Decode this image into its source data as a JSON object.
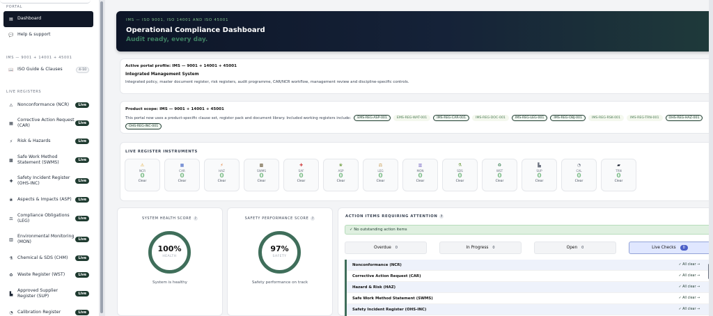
{
  "sidebar": {
    "sections": {
      "portal": "PORTAL",
      "ims": "IMS — 9001 + 14001 + 45001",
      "live": "LIVE REGISTERS"
    },
    "items": [
      {
        "label": "Dashboard",
        "icon": "dashboard-icon",
        "glyph": "▤"
      },
      {
        "label": "Help & support",
        "icon": "chat-icon",
        "glyph": "💬"
      },
      {
        "label": "ISO Guide & Clauses",
        "icon": "book-icon",
        "glyph": "📖",
        "badge": "4–10"
      },
      {
        "label": "Nonconformance (NCR)",
        "icon": "warning-icon",
        "glyph": "⚠",
        "badge": "Live"
      },
      {
        "label": "Corrective Action Request (CAR)",
        "icon": "form-icon",
        "glyph": "▦",
        "badge": "Live"
      },
      {
        "label": "Risk & Hazards",
        "icon": "flame-icon",
        "glyph": "⚡",
        "badge": "Live"
      },
      {
        "label": "Safe Work Method Statement (SWMS)",
        "icon": "swms-icon",
        "glyph": "▩",
        "badge": "Live"
      },
      {
        "label": "Safety Incident Register (OHS-INC)",
        "icon": "ambulance-icon",
        "glyph": "✚",
        "badge": "Live"
      },
      {
        "label": "Aspects & Impacts (ASP)",
        "icon": "plant-icon",
        "glyph": "❀",
        "badge": "Live"
      },
      {
        "label": "Compliance Obligations (LEG)",
        "icon": "scales-icon",
        "glyph": "⚖",
        "badge": "Live"
      },
      {
        "label": "Environmental Monitoring (MON)",
        "icon": "chart-icon",
        "glyph": "▥",
        "badge": "Live"
      },
      {
        "label": "Chemical & SDS (CHM)",
        "icon": "flask-icon",
        "glyph": "⚗",
        "badge": "Live"
      },
      {
        "label": "Waste Register (WST)",
        "icon": "recycle-icon",
        "glyph": "♻",
        "badge": "Live"
      },
      {
        "label": "Approved Supplier Register (SUP)",
        "icon": "factory-icon",
        "glyph": "▙",
        "badge": "Live"
      },
      {
        "label": "Calibration Register",
        "icon": "gauge-icon",
        "glyph": "◔",
        "badge": "Live"
      }
    ]
  },
  "hero": {
    "kicker": "IMS — ISO 9001, ISO 14001 AND ISO 45001",
    "title": "Operational Compliance Dashboard",
    "tagline": "Audit ready, every day."
  },
  "profile": {
    "label": "Active portal profile: IMS — 9001 + 14001 + 45001",
    "system": "Integrated Management System",
    "description": "Integrated policy, master document register, risk registers, audit programme, CAR/NCR workflow, management review and discipline-specific controls."
  },
  "scope": {
    "title": "Product scope: IMS — 9001 + 14001 + 45001",
    "text": "This portal now uses a product-specific clause set, register pack and document library. Included working registers include:",
    "chips": [
      "EMS-REG-ASP-001",
      "EMS-REG-WAT-001",
      "IMS-REG-CAR-001",
      "IMS-REG-DOC-001",
      "IMS-REG-LEG-001",
      "IMS-REG-OBJ-001",
      "IMS-REG-RSK-001",
      "IMS-REG-TRN-001",
      "OHS-REG-HAZ-001",
      "OHS-REG-INC-001"
    ],
    "plain_chips": [
      "EMS-REG-WAT-001",
      "IMS-REG-DOC-001",
      "IMS-REG-RSK-001",
      "IMS-REG-TRN-001"
    ]
  },
  "registers": {
    "title": "LIVE REGISTER INSTRUMENTS",
    "items": [
      {
        "code": "NCR",
        "count": "0",
        "status": "Clear",
        "icon": "warning-icon",
        "glyph": "⚠",
        "color": "#e0a020"
      },
      {
        "code": "CAR",
        "count": "0",
        "status": "Clear",
        "icon": "form-icon",
        "glyph": "▦",
        "color": "#4b6cc7"
      },
      {
        "code": "HAZ",
        "count": "0",
        "status": "Clear",
        "icon": "flame-icon",
        "glyph": "⚡",
        "color": "#e07020"
      },
      {
        "code": "SWMS",
        "count": "0",
        "status": "Clear",
        "icon": "swms-icon",
        "glyph": "▩",
        "color": "#6b5b3a"
      },
      {
        "code": "SAF",
        "count": "0",
        "status": "Clear",
        "icon": "ambulance-icon",
        "glyph": "✚",
        "color": "#d04040"
      },
      {
        "code": "ASP",
        "count": "0",
        "status": "Clear",
        "icon": "plant-icon",
        "glyph": "❀",
        "color": "#6a9b3a"
      },
      {
        "code": "LEG",
        "count": "0",
        "status": "Clear",
        "icon": "scales-icon",
        "glyph": "⚖",
        "color": "#c08a30"
      },
      {
        "code": "MON",
        "count": "0",
        "status": "Clear",
        "icon": "chart-icon",
        "glyph": "▥",
        "color": "#7b6cc7"
      },
      {
        "code": "SDS",
        "count": "0",
        "status": "Clear",
        "icon": "flask-icon",
        "glyph": "⚗",
        "color": "#6a9b3a"
      },
      {
        "code": "WST",
        "count": "0",
        "status": "Clear",
        "icon": "recycle-icon",
        "glyph": "♻",
        "color": "#2f7a4a"
      },
      {
        "code": "SUP",
        "count": "0",
        "status": "Clear",
        "icon": "factory-icon",
        "glyph": "▙",
        "color": "#6b7280"
      },
      {
        "code": "CAL",
        "count": "0",
        "status": "Clear",
        "icon": "gauge-icon",
        "glyph": "◔",
        "color": "#6b7280"
      },
      {
        "code": "TRN",
        "count": "0",
        "status": "Clear",
        "icon": "graduation-icon",
        "glyph": "▰",
        "color": "#111827"
      }
    ]
  },
  "health": {
    "title": "SYSTEM HEALTH SCORE",
    "pct": "100%",
    "sub": "HEALTH",
    "note": "System is healthy",
    "help": "?"
  },
  "safety": {
    "title": "SAFETY PERFORMANCE SCORE",
    "pct": "97%",
    "sub": "SAFETY",
    "note": "Safety performance on track",
    "help": "?"
  },
  "actions": {
    "title": "ACTION ITEMS REQUIRING ATTENTION",
    "help": "?",
    "banner": "✓ No outstanding action items",
    "tabs": [
      {
        "label": "Overdue",
        "count": "0"
      },
      {
        "label": "In Progress",
        "count": "0"
      },
      {
        "label": "Open",
        "count": "0"
      },
      {
        "label": "Live Checks",
        "count": "0"
      }
    ],
    "rows": [
      {
        "label": "Nonconformance (NCR)",
        "status": "✓ All clear →"
      },
      {
        "label": "Corrective Action Request (CAR)",
        "status": "✓ All clear →"
      },
      {
        "label": "Hazard & Risk (HAZ)",
        "status": "✓ All clear →"
      },
      {
        "label": "Safe Work Method Statement (SWMS)",
        "status": "✓ All clear →"
      },
      {
        "label": "Safety Incident Register (OHS-INC)",
        "status": "✓ All clear →"
      }
    ]
  },
  "colors": {
    "accent_green": "#1f3b30",
    "hero_dark": "#0d1527",
    "gauge": "#3f6e5a",
    "count_green": "#7fbf8a"
  }
}
